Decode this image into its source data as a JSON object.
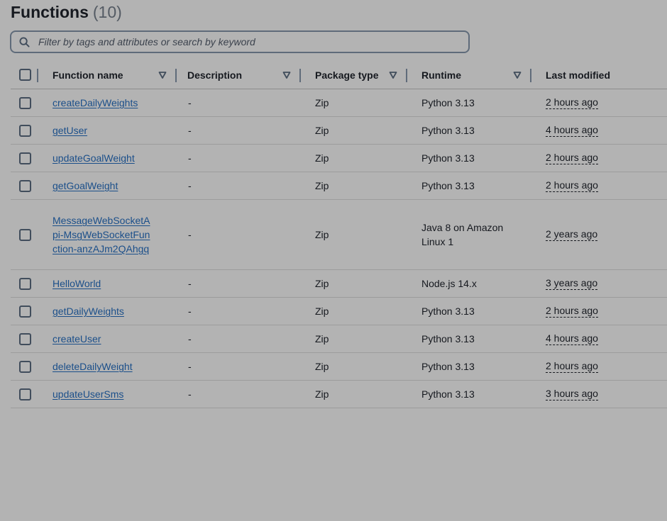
{
  "page": {
    "title": "Functions",
    "count": "(10)"
  },
  "search": {
    "placeholder": "Filter by tags and attributes or search by keyword"
  },
  "columns": {
    "name": "Function name",
    "description": "Description",
    "package": "Package type",
    "runtime": "Runtime",
    "modified": "Last modified"
  },
  "rows": [
    {
      "name": "createDailyWeights",
      "description": "-",
      "package": "Zip",
      "runtime": "Python 3.13",
      "modified": "2 hours ago"
    },
    {
      "name": "getUser",
      "description": "-",
      "package": "Zip",
      "runtime": "Python 3.13",
      "modified": "4 hours ago"
    },
    {
      "name": "updateGoalWeight",
      "description": "-",
      "package": "Zip",
      "runtime": "Python 3.13",
      "modified": "2 hours ago"
    },
    {
      "name": "getGoalWeight",
      "description": "-",
      "package": "Zip",
      "runtime": "Python 3.13",
      "modified": "2 hours ago"
    },
    {
      "name": "MessageWebSocketApi-MsgWebSocketFunction-anzAJm2QAhgq",
      "description": "-",
      "package": "Zip",
      "runtime": "Java 8 on Amazon Linux 1",
      "modified": "2 years ago"
    },
    {
      "name": "HelloWorld",
      "description": "-",
      "package": "Zip",
      "runtime": "Node.js 14.x",
      "modified": "3 years ago"
    },
    {
      "name": "getDailyWeights",
      "description": "-",
      "package": "Zip",
      "runtime": "Python 3.13",
      "modified": "2 hours ago"
    },
    {
      "name": "createUser",
      "description": "-",
      "package": "Zip",
      "runtime": "Python 3.13",
      "modified": "4 hours ago"
    },
    {
      "name": "deleteDailyWeight",
      "description": "-",
      "package": "Zip",
      "runtime": "Python 3.13",
      "modified": "2 hours ago"
    },
    {
      "name": "updateUserSms",
      "description": "-",
      "package": "Zip",
      "runtime": "Python 3.13",
      "modified": "3 hours ago"
    }
  ]
}
